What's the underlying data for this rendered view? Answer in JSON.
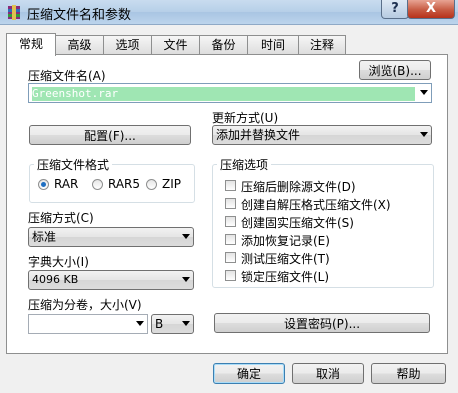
{
  "window": {
    "title": "压缩文件名和参数",
    "help_button": "?",
    "close_button": "X"
  },
  "tabs": [
    {
      "label": "常规",
      "active": true
    },
    {
      "label": "高级"
    },
    {
      "label": "选项"
    },
    {
      "label": "文件"
    },
    {
      "label": "备份"
    },
    {
      "label": "时间"
    },
    {
      "label": "注释"
    }
  ],
  "archive_name": {
    "label": "压缩文件名(A)",
    "browse_button": "浏览(B)...",
    "value": "Greenshot.rar"
  },
  "update_mode": {
    "label": "更新方式(U)",
    "value": "添加并替换文件"
  },
  "profiles_button": "配置(F)...",
  "archive_format": {
    "title": "压缩文件格式",
    "options": [
      "RAR",
      "RAR5",
      "ZIP"
    ],
    "selected": "RAR"
  },
  "compression_method": {
    "label": "压缩方式(C)",
    "value": "标准"
  },
  "dictionary_size": {
    "label": "字典大小(I)",
    "value": "4096 KB"
  },
  "split_volumes": {
    "label": "压缩为分卷，大小(V)",
    "value": "",
    "unit": "B"
  },
  "archive_options": {
    "title": "压缩选项",
    "items": [
      {
        "label": "压缩后删除源文件(D)",
        "checked": false
      },
      {
        "label": "创建自解压格式压缩文件(X)",
        "checked": false
      },
      {
        "label": "创建固实压缩文件(S)",
        "checked": false
      },
      {
        "label": "添加恢复记录(E)",
        "checked": false
      },
      {
        "label": "测试压缩文件(T)",
        "checked": false
      },
      {
        "label": "锁定压缩文件(L)",
        "checked": false
      }
    ]
  },
  "set_password_button": "设置密码(P)...",
  "dialog_buttons": {
    "ok": "确定",
    "cancel": "取消",
    "help": "帮助"
  }
}
